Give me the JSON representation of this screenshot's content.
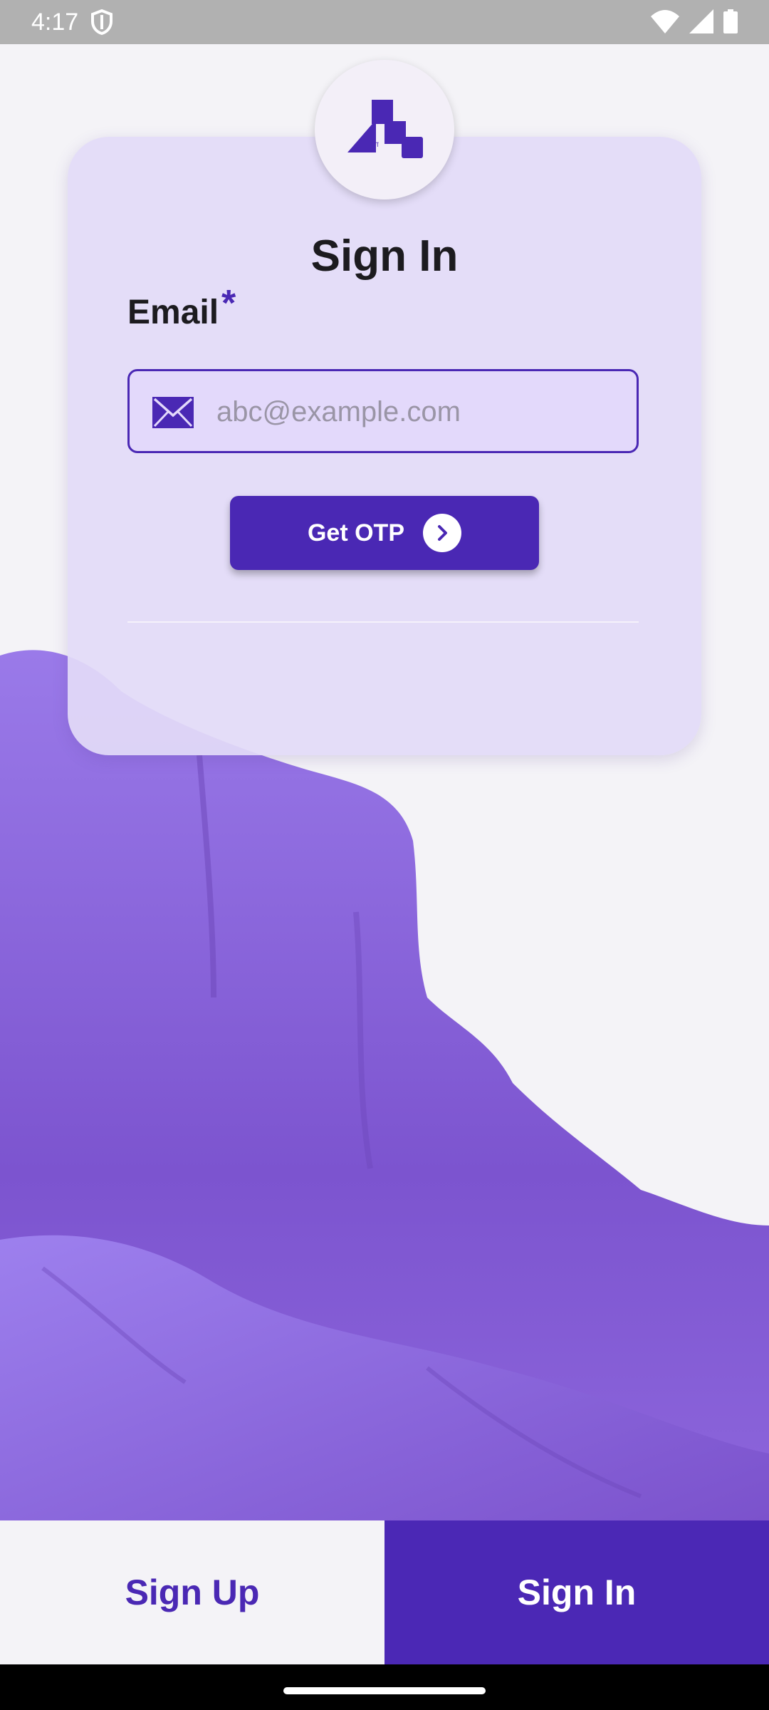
{
  "status_bar": {
    "time": "4:17",
    "icons": [
      "shield-icon",
      "wifi-icon",
      "signal-icon",
      "battery-icon"
    ]
  },
  "colors": {
    "primary": "#4a28b4",
    "card": "#e2daf8",
    "field": "#e3d9fb",
    "background": "#f4f3f7",
    "art": "#8e6be0"
  },
  "card": {
    "logo_icon": "app-logo",
    "title": "Sign In",
    "email_label": "Email",
    "required_mark": "*",
    "email_placeholder": "abc@example.com",
    "email_value": "",
    "email_icon": "mail-icon",
    "otp_button": "Get OTP",
    "otp_button_icon": "chevron-right-icon"
  },
  "tabs": {
    "sign_up": "Sign Up",
    "sign_in": "Sign In",
    "selected": "Sign In"
  }
}
